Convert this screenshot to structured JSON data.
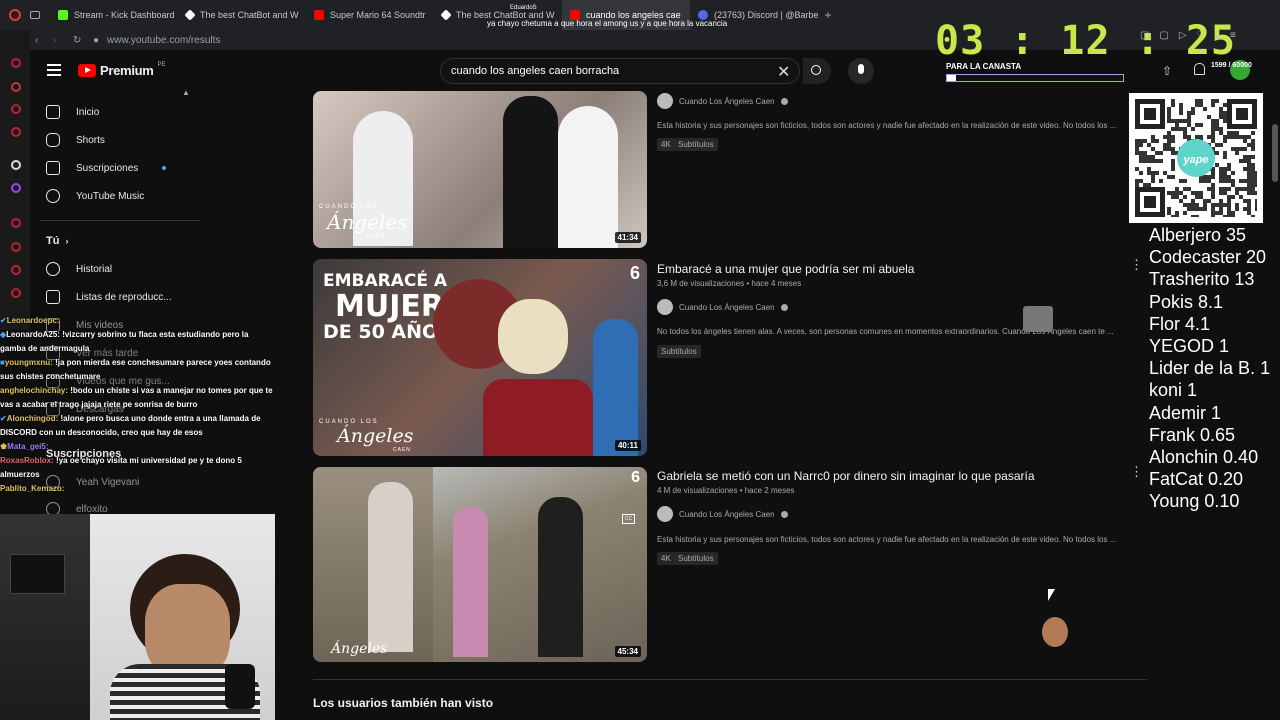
{
  "browser": {
    "tabs": [
      {
        "label": "Stream - Kick Dashboard",
        "color": "#53fc18"
      },
      {
        "label": "The best ChatBot and W",
        "color": "#ffffff"
      },
      {
        "label": "Super Mario 64 Soundtr",
        "color": "#ff0000"
      },
      {
        "label": "The best ChatBot and W",
        "color": "#ffffff"
      },
      {
        "label": "cuando los angeles cae",
        "color": "#ff0000"
      },
      {
        "label": "(23763) Discord | @Barbe",
        "color": "#5865f2"
      }
    ],
    "tab_overlay_name": "EduardoS",
    "tab_overlay_msg": "ya chayo chetuma a que hora el among us y a que hora la vacancia",
    "url": "www.youtube.com/results"
  },
  "youtube": {
    "logo": "Premium",
    "logo_region": "PE",
    "search_query": "cuando los angeles caen borracha",
    "sidebar": {
      "items": [
        {
          "label": "Inicio",
          "icon": "home-icon"
        },
        {
          "label": "Shorts",
          "icon": "shorts-icon"
        },
        {
          "label": "Suscripciones",
          "icon": "subscriptions-icon"
        },
        {
          "label": "YouTube Music",
          "icon": "music-icon"
        }
      ],
      "you_label": "Tú",
      "you_items": [
        {
          "label": "Historial",
          "icon": "history-icon"
        },
        {
          "label": "Listas de reproducc...",
          "icon": "playlist-icon"
        },
        {
          "label": "Mis videos",
          "icon": "videos-icon"
        },
        {
          "label": "Ver más tarde",
          "icon": "watch-later-icon"
        },
        {
          "label": "Videos que me gus...",
          "icon": "like-icon"
        },
        {
          "label": "Descargas",
          "icon": "download-icon"
        }
      ],
      "subs_label": "Suscripciones",
      "sub_items": [
        {
          "label": "Yeah Vigevani"
        },
        {
          "label": "elfoxito"
        }
      ]
    },
    "results": [
      {
        "title": "",
        "channel": "Cuando Los Ángeles Caen",
        "meta": "",
        "desc": "Esta historia y sus personajes son ficticios, todos son actores y nadie fue afectado en la realización de este video. No todos los ...",
        "badges": [
          "4K",
          "Subtítulos"
        ],
        "duration": "41:34",
        "brand": "CUANDO LOS",
        "brand_script": "Ángeles",
        "brand_sub": "CAEN"
      },
      {
        "title": "Embaracé a una mujer que podría ser mi abuela",
        "channel": "Cuando Los Ángeles Caen",
        "meta": "3,6 M de visualizaciones • hace 4 meses",
        "desc": "No todos los ángeles tienen alas. A veces, son personas comunes en momentos extraordinarios. Cuando Los Ángeles caen te ...",
        "badges": [
          "Subtítulos"
        ],
        "duration": "40:11",
        "thumb_text": [
          "EMBARACÉ A",
          "MUJER",
          "DE 50 AÑOS"
        ],
        "brand": "CUANDO LOS",
        "brand_script": "Ángeles",
        "brand_sub": "CAEN"
      },
      {
        "title": "Gabriela se metió con un Narrc0 por dinero sin imaginar lo que pasaría",
        "channel": "Cuando Los Ángeles Caen",
        "meta": "4 M de visualizaciones • hace 2 meses",
        "desc": "Esta historia y sus personajes son ficticios, todos son actores y nadie fue afectado en la realización de este video. No todos los ...",
        "badges": [
          "4K",
          "Subtítulos"
        ],
        "duration": "45:34",
        "brand_script": "Ángeles"
      }
    ],
    "also_watched": "Los usuarios también han visto"
  },
  "chat": [
    {
      "user": "Leonardoepc:",
      "msg": "",
      "color": "#e1c45b"
    },
    {
      "user": "LeonardoA25:",
      "msg": "!vizcarry sobrino tu flaca esta estudiando pero la gamba de andermagula",
      "color": "#ffffff"
    },
    {
      "user": "youngmxnu:",
      "msg": "!ja pon mierda ese conchesumare parece yoes contando sus chistes conchetumare",
      "color": "#e1c45b"
    },
    {
      "user": "anghelochinchay:",
      "msg": "!bodo un chiste si vas a manejar no tomes por que te vas a acabar el trago jajaja riete pe sonrisa de burro",
      "color": "#e1c45b"
    },
    {
      "user": "Alonchingod:",
      "msg": "!alone pero busca uno donde entra a una llamada de DISCORD con un desconocido, creo que hay de esos",
      "color": "#e1c45b"
    },
    {
      "user": "Mata_gei5:",
      "msg": "",
      "color": "#9b7bff"
    },
    {
      "user": "RoxasRoblox:",
      "msg": "!ya oe chayo visita mi universidad pe y te dono 5 almuerzos",
      "color": "#e36a6a"
    },
    {
      "user": "Pablito_Kemazo:",
      "msg": "",
      "color": "#e1c45b"
    }
  ],
  "overlay": {
    "timer": "03 : 12 : 25",
    "goal_label": "PARA LA CANASTA",
    "goal_progress": 0.05,
    "goal_text": "1599 / 60000",
    "qr_brand": "yape",
    "leaderboard": [
      "Alberjero 35",
      "Codecaster 20",
      "Trasherito 13",
      "Pokis 8.1",
      "Flor 4.1",
      "YEGOD 1",
      "Lider de la B. 1",
      "koni 1",
      "Ademir 1",
      "Frank 0.65",
      "Alonchin 0.40",
      "FatCat 0.20",
      "Young 0.10"
    ]
  },
  "colors": {
    "yt_red": "#ff0000",
    "timer": "#c8e84a",
    "bg": "#0f0f0f"
  }
}
